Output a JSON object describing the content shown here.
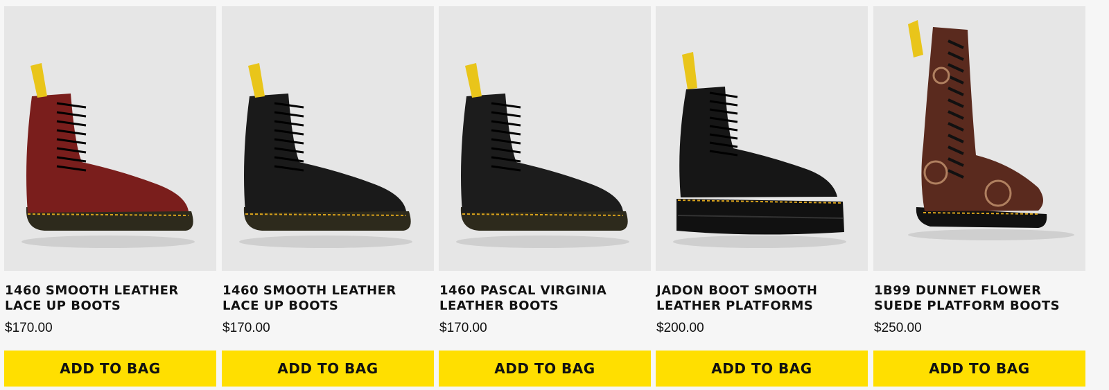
{
  "products": [
    {
      "title": "1460 SMOOTH LEATHER\nLACE UP BOOTS",
      "price": "$170.00",
      "cta": "ADD TO BAG",
      "image_alt": "Cherry red 1460 smooth leather boot",
      "boot_color": "#7a1e1c",
      "style": "1460"
    },
    {
      "title": "1460 SMOOTH LEATHER\nLACE UP BOOTS",
      "price": "$170.00",
      "cta": "ADD TO BAG",
      "image_alt": "Black 1460 smooth leather boot",
      "boot_color": "#1a1a1a",
      "style": "1460"
    },
    {
      "title": "1460 PASCAL VIRGINIA\nLEATHER BOOTS",
      "price": "$170.00",
      "cta": "ADD TO BAG",
      "image_alt": "Black 1460 Pascal Virginia leather boot",
      "boot_color": "#1c1c1c",
      "style": "1460"
    },
    {
      "title": "JADON BOOT SMOOTH\nLEATHER PLATFORMS",
      "price": "$200.00",
      "cta": "ADD TO BAG",
      "image_alt": "Black Jadon smooth leather platform boot",
      "boot_color": "#161616",
      "style": "platform"
    },
    {
      "title": "1B99 DUNNET FLOWER\nSUEDE PLATFORM BOOTS",
      "price": "$250.00",
      "cta": "ADD TO BAG",
      "image_alt": "Brown 1B99 Dunnet flower suede platform boot",
      "boot_color": "#5a2a1e",
      "style": "tall"
    }
  ],
  "colors": {
    "button_bg": "#ffdf00",
    "image_bg": "#e6e6e6",
    "page_bg": "#f6f6f6",
    "text": "#111111",
    "welt_stitch": "#d9a21b",
    "pull_tab": "#e9c51a"
  }
}
